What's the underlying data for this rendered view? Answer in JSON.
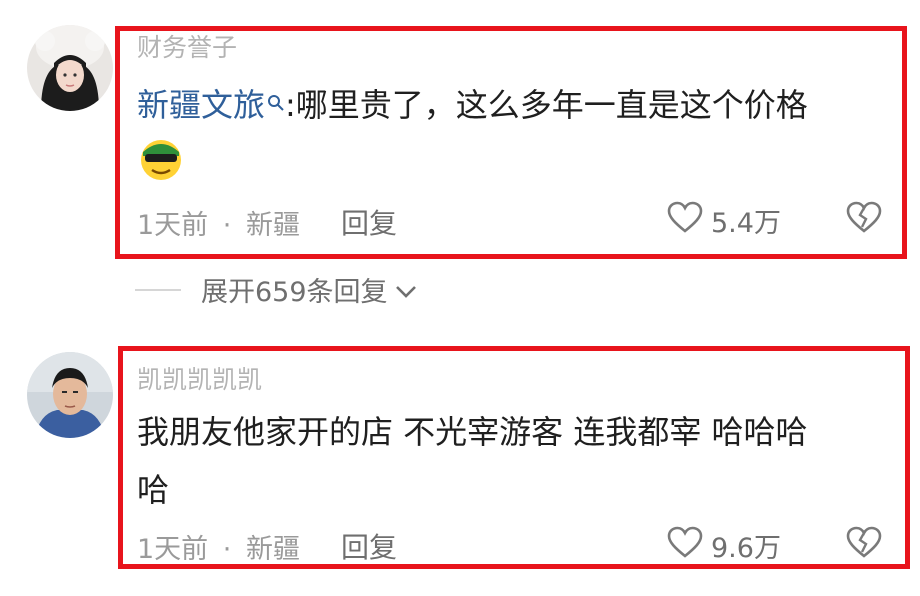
{
  "comments": [
    {
      "username": "财务誉子",
      "mention": "新疆文旅",
      "text": ":哪里贵了，这么多年一直是这个价格",
      "emoji_icon": "sunglasses-emoji",
      "time": "1天前",
      "dot": "·",
      "location": "新疆",
      "reply": "回复",
      "likes": "5.4万"
    },
    {
      "username": "凯凯凯凯凯",
      "text_line1": "我朋友他家开的店 不光宰游客 连我都宰 哈哈哈",
      "text_line2": "哈",
      "time": "1天前",
      "dot": "·",
      "location": "新疆",
      "reply": "回复",
      "likes": "9.6万"
    }
  ],
  "expand_replies": "展开659条回复",
  "colors": {
    "highlight": "#e8141c",
    "mention": "#2f5f9a"
  }
}
